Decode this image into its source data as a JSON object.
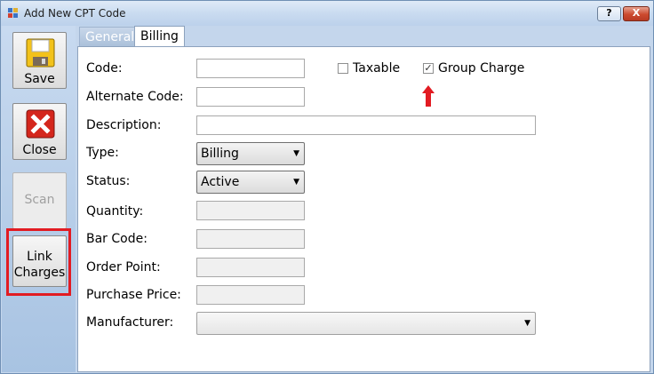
{
  "window": {
    "title": "Add New CPT Code",
    "help_label": "?",
    "close_label": "X"
  },
  "sidebar": {
    "save": "Save",
    "close": "Close",
    "scan": "Scan",
    "link_line1": "Link",
    "link_line2": "Charges"
  },
  "tabs": {
    "general": "General",
    "billing": "Billing"
  },
  "form": {
    "code_label": "Code:",
    "alt_code_label": "Alternate Code:",
    "description_label": "Description:",
    "type_label": "Type:",
    "type_value": "Billing",
    "status_label": "Status:",
    "status_value": "Active",
    "quantity_label": "Quantity:",
    "barcode_label": "Bar Code:",
    "order_point_label": "Order Point:",
    "purchase_price_label": "Purchase Price:",
    "manufacturer_label": "Manufacturer:",
    "taxable_label": "Taxable",
    "taxable_checked": false,
    "group_charge_label": "Group Charge",
    "group_charge_checked": true
  },
  "colors": {
    "highlight": "#e21b22",
    "annotation_arrow": "#e21b22"
  }
}
